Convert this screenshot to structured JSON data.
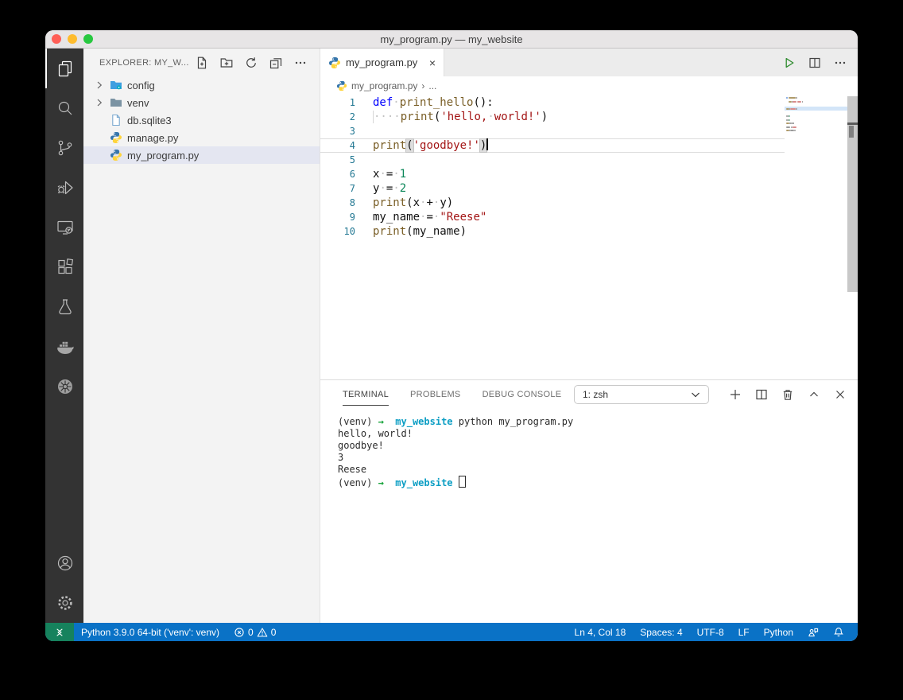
{
  "window": {
    "title": "my_program.py — my_website"
  },
  "titlebar_controls": [
    "close",
    "minimize",
    "zoom"
  ],
  "activity_bar": {
    "items": [
      {
        "name": "explorer",
        "active": true
      },
      {
        "name": "search",
        "active": false
      },
      {
        "name": "source-control",
        "active": false
      },
      {
        "name": "run-and-debug",
        "active": false
      },
      {
        "name": "remote-explorer",
        "active": false
      },
      {
        "name": "extensions",
        "active": false
      },
      {
        "name": "testing",
        "active": false
      },
      {
        "name": "docker",
        "active": false
      },
      {
        "name": "kubernetes",
        "active": false
      }
    ],
    "bottom_items": [
      {
        "name": "account",
        "active": false
      },
      {
        "name": "settings",
        "active": false
      }
    ]
  },
  "sidebar": {
    "header": "EXPLORER: MY_W...",
    "actions": [
      "new-file",
      "new-folder",
      "refresh",
      "collapse-all",
      "more"
    ],
    "tree": [
      {
        "label": "config",
        "type": "folder-config",
        "chevron": true,
        "selected": false
      },
      {
        "label": "venv",
        "type": "folder",
        "chevron": true,
        "selected": false
      },
      {
        "label": "db.sqlite3",
        "type": "file",
        "chevron": false,
        "selected": false
      },
      {
        "label": "manage.py",
        "type": "python",
        "chevron": false,
        "selected": false
      },
      {
        "label": "my_program.py",
        "type": "python",
        "chevron": false,
        "selected": true
      }
    ]
  },
  "editor": {
    "tab_label": "my_program.py",
    "tab_close": "×",
    "actions": [
      "run",
      "split-editor",
      "more"
    ],
    "breadcrumb": {
      "file": "my_program.py",
      "separator": "›",
      "more": "..."
    },
    "cursor": {
      "line": 4,
      "col": 18
    },
    "lines": [
      {
        "n": 1,
        "tokens": [
          {
            "c": "kw",
            "s": "def"
          },
          {
            "c": "ws",
            "s": " "
          },
          {
            "c": "fn",
            "s": "print_hello"
          },
          {
            "c": "pl",
            "s": "():"
          }
        ]
      },
      {
        "n": 2,
        "tokens": [
          {
            "c": "wsi",
            "s": "    "
          },
          {
            "c": "fn",
            "s": "print"
          },
          {
            "c": "pl",
            "s": "("
          },
          {
            "c": "str",
            "s": "'hello,"
          },
          {
            "c": "ws",
            "s": " "
          },
          {
            "c": "str",
            "s": "world!'"
          },
          {
            "c": "pl",
            "s": ")"
          }
        ]
      },
      {
        "n": 3,
        "tokens": []
      },
      {
        "n": 4,
        "current": true,
        "caret": true,
        "tokens": [
          {
            "c": "fn",
            "s": "print"
          },
          {
            "c": "pl bm",
            "s": "("
          },
          {
            "c": "str",
            "s": "'goodbye!'"
          },
          {
            "c": "pl bm",
            "s": ")"
          }
        ]
      },
      {
        "n": 5,
        "tokens": []
      },
      {
        "n": 6,
        "tokens": [
          {
            "c": "v",
            "s": "x"
          },
          {
            "c": "ws",
            "s": " "
          },
          {
            "c": "pl",
            "s": "="
          },
          {
            "c": "ws",
            "s": " "
          },
          {
            "c": "num",
            "s": "1"
          }
        ]
      },
      {
        "n": 7,
        "tokens": [
          {
            "c": "v",
            "s": "y"
          },
          {
            "c": "ws",
            "s": " "
          },
          {
            "c": "pl",
            "s": "="
          },
          {
            "c": "ws",
            "s": " "
          },
          {
            "c": "num",
            "s": "2"
          }
        ]
      },
      {
        "n": 8,
        "tokens": [
          {
            "c": "fn",
            "s": "print"
          },
          {
            "c": "pl",
            "s": "("
          },
          {
            "c": "v",
            "s": "x"
          },
          {
            "c": "ws",
            "s": " "
          },
          {
            "c": "pl",
            "s": "+"
          },
          {
            "c": "ws",
            "s": " "
          },
          {
            "c": "v",
            "s": "y"
          },
          {
            "c": "pl",
            "s": ")"
          }
        ]
      },
      {
        "n": 9,
        "tokens": [
          {
            "c": "v",
            "s": "my_name"
          },
          {
            "c": "ws",
            "s": " "
          },
          {
            "c": "pl",
            "s": "="
          },
          {
            "c": "ws",
            "s": " "
          },
          {
            "c": "str",
            "s": "\"Reese\""
          }
        ]
      },
      {
        "n": 10,
        "tokens": [
          {
            "c": "fn",
            "s": "print"
          },
          {
            "c": "pl",
            "s": "("
          },
          {
            "c": "v",
            "s": "my_name"
          },
          {
            "c": "pl",
            "s": ")"
          }
        ]
      }
    ]
  },
  "panel": {
    "tabs": [
      {
        "label": "TERMINAL",
        "active": true
      },
      {
        "label": "PROBLEMS",
        "active": false
      },
      {
        "label": "DEBUG CONSOLE",
        "active": false
      }
    ],
    "dropdown_value": "1: zsh",
    "actions": [
      "new-terminal",
      "split-terminal",
      "kill-terminal",
      "maximize-panel",
      "close-panel"
    ]
  },
  "terminal": {
    "lines": [
      [
        {
          "c": "t",
          "s": "(venv) "
        },
        {
          "c": "tgreen",
          "s": "→"
        },
        {
          "c": "t",
          "s": "  "
        },
        {
          "c": "tcyan",
          "s": "my_website"
        },
        {
          "c": "t",
          "s": " python my_program.py"
        }
      ],
      [
        {
          "c": "t",
          "s": "hello, world!"
        }
      ],
      [
        {
          "c": "t",
          "s": "goodbye!"
        }
      ],
      [
        {
          "c": "t",
          "s": "3"
        }
      ],
      [
        {
          "c": "t",
          "s": "Reese"
        }
      ],
      [
        {
          "c": "t",
          "s": "(venv) "
        },
        {
          "c": "tgreen",
          "s": "→"
        },
        {
          "c": "t",
          "s": "  "
        },
        {
          "c": "tcyan",
          "s": "my_website"
        },
        {
          "c": "t",
          "s": " "
        },
        {
          "c": "tcursor",
          "s": ""
        }
      ]
    ]
  },
  "status_bar": {
    "left": [
      {
        "name": "remote-indicator",
        "icon": "remote"
      },
      {
        "name": "python-interpreter",
        "label": "Python 3.9.0 64-bit ('venv': venv)"
      },
      {
        "name": "problems",
        "segments": [
          {
            "icon": "error"
          },
          {
            "text": "0"
          },
          {
            "icon": "warning"
          },
          {
            "text": "0"
          }
        ]
      }
    ],
    "right": [
      {
        "name": "cursor-position",
        "label": "Ln 4, Col 18"
      },
      {
        "name": "indentation",
        "label": "Spaces: 4"
      },
      {
        "name": "encoding",
        "label": "UTF-8"
      },
      {
        "name": "end-of-line",
        "label": "LF"
      },
      {
        "name": "language-mode",
        "label": "Python"
      },
      {
        "name": "feedback",
        "icon": "feedback"
      },
      {
        "name": "notifications",
        "icon": "bell"
      }
    ]
  },
  "colors": {
    "status_bar": "#0a72c6",
    "remote_item": "#16825d",
    "activity_bar": "#333333",
    "sidebar": "#f3f3f3",
    "selection_row": "#e4e6f1",
    "keyword": "#0000ff",
    "function": "#795E26",
    "string": "#a31515",
    "number": "#098658",
    "line_number": "#237893",
    "terminal_green": "#16a33a",
    "terminal_cyan": "#0c9ec4",
    "run_button": "#2e8b2e"
  }
}
